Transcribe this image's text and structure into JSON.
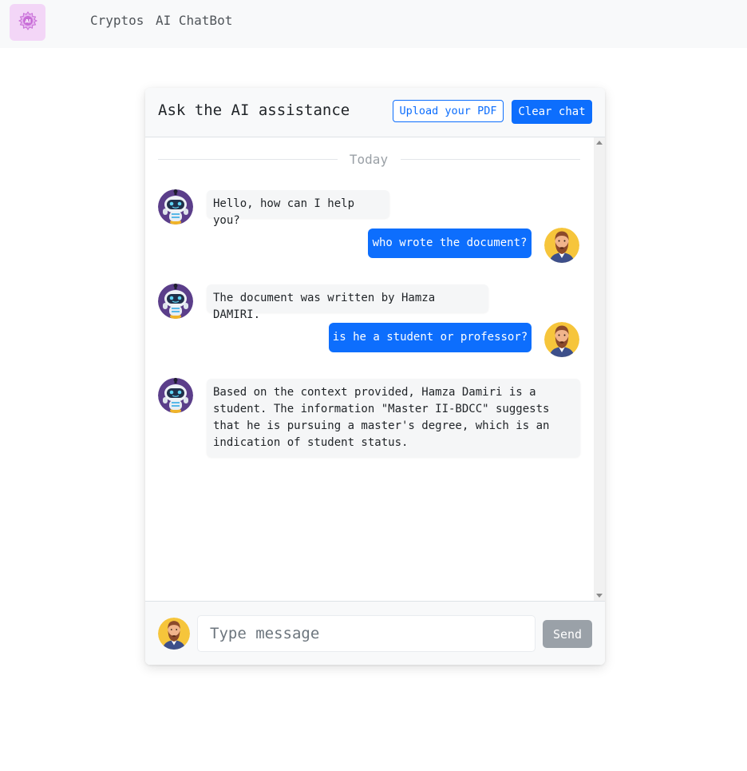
{
  "navbar": {
    "logo_text": "AI",
    "links": [
      "Cryptos",
      "AI ChatBot"
    ]
  },
  "chat": {
    "title": "Ask the AI assistance",
    "upload_label": "Upload your PDF",
    "clear_label": "Clear chat",
    "divider_label": "Today",
    "messages": [
      {
        "role": "bot",
        "text": "Hello, how can I help you?"
      },
      {
        "role": "user",
        "text": "who wrote the document?"
      },
      {
        "role": "bot",
        "text": "The document was written by Hamza DAMIRI."
      },
      {
        "role": "user",
        "text": "is he a student or professor?"
      },
      {
        "role": "bot",
        "text": "Based on the context provided, Hamza Damiri is a student. The information \"Master II-BDCC\" suggests that he is pursuing a master's degree, which is an indication of student status."
      }
    ],
    "input_placeholder": "Type message",
    "send_label": "Send"
  },
  "colors": {
    "accent": "#0d6efd",
    "send_disabled": "#9aa1a8",
    "logo_bg": "#f3d6f7",
    "logo_fg": "#c86dd7"
  },
  "icons": {
    "logo": "ai-chip-icon",
    "bot_avatar": "robot-avatar-icon",
    "user_avatar": "bearded-man-avatar-icon"
  }
}
